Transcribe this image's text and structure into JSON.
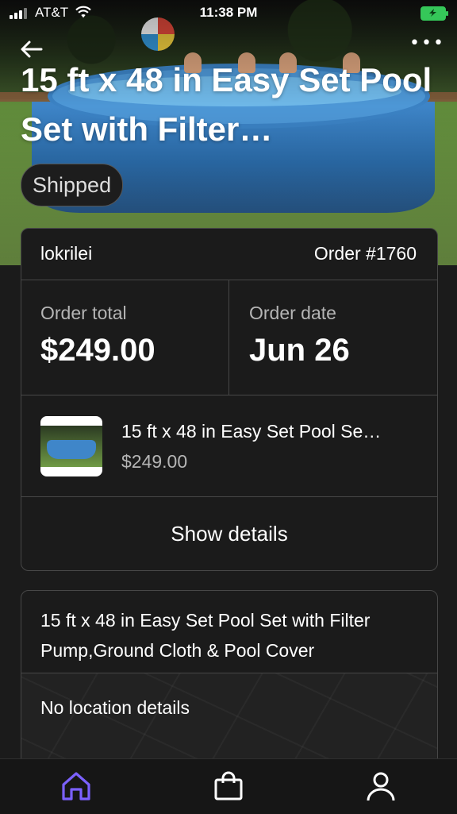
{
  "status_bar": {
    "carrier": "AT&T",
    "time": "11:38 PM"
  },
  "header": {
    "title": "15 ft x 48 in Easy Set Pool Set with Filter…",
    "status": "Shipped"
  },
  "order": {
    "buyer": "lokrilei",
    "order_number": "Order #1760",
    "total_label": "Order total",
    "total_value": "$249.00",
    "date_label": "Order date",
    "date_value": "Jun 26",
    "item_title": "15 ft x 48 in Easy Set Pool Se…",
    "item_price": "$249.00",
    "show_details": "Show details"
  },
  "details": {
    "full_title": "15 ft x 48 in Easy Set Pool Set with Filter Pump,Ground Cloth & Pool Cover",
    "location": "No location details"
  },
  "colors": {
    "background": "#1b1b1b",
    "accent": "#7b61ff",
    "battery": "#35c759"
  },
  "icons": [
    "back-arrow-icon",
    "more-icon",
    "home-icon",
    "shopping-bag-icon",
    "profile-icon"
  ]
}
